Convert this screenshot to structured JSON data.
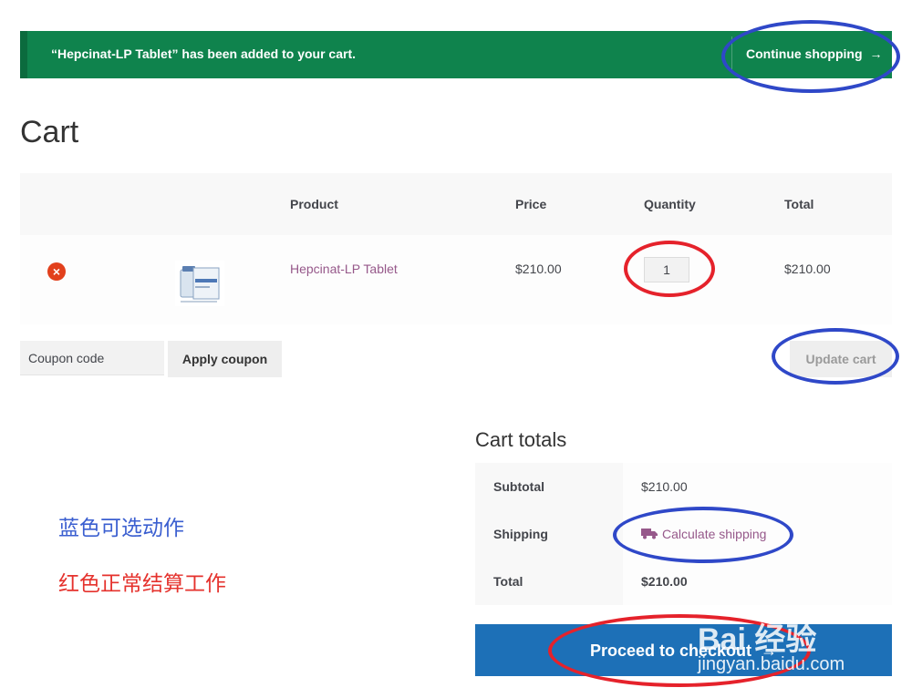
{
  "notice": {
    "message": "“Hepcinat-LP Tablet” has been added to your cart.",
    "continue_label": "Continue shopping",
    "continue_arrow": "→"
  },
  "page": {
    "title": "Cart"
  },
  "cart_table": {
    "headers": {
      "product": "Product",
      "price": "Price",
      "quantity": "Quantity",
      "total": "Total"
    },
    "rows": [
      {
        "remove_icon": "remove-icon",
        "product": "Hepcinat-LP Tablet",
        "price": "$210.00",
        "quantity": "1",
        "total": "$210.00"
      }
    ]
  },
  "coupon": {
    "placeholder": "Coupon code",
    "apply_label": "Apply coupon",
    "update_label": "Update cart"
  },
  "cart_totals": {
    "title": "Cart totals",
    "subtotal_label": "Subtotal",
    "subtotal_value": "$210.00",
    "shipping_label": "Shipping",
    "shipping_link": "Calculate shipping",
    "total_label": "Total",
    "total_value": "$210.00"
  },
  "checkout": {
    "label": "Proceed to checkout",
    "arrow": "→"
  },
  "annotations": {
    "blue_note": "蓝色可选动作",
    "red_note": "红色正常结算工作"
  },
  "watermark": {
    "brand": "Bai 经验",
    "url": "jingyan.baidu.com"
  },
  "colors": {
    "notice_bg": "#0f834d",
    "link": "#96588a",
    "checkout_bg": "#1d70b7",
    "annotation_blue": "#2f48c8",
    "annotation_red": "#e5222b",
    "remove": "#e2401c"
  }
}
